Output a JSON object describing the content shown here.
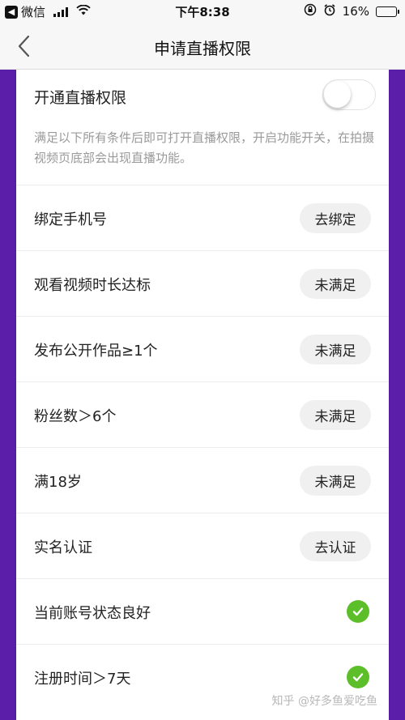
{
  "status_bar": {
    "back_app": "微信",
    "time": "下午8:38",
    "battery": "16%",
    "battery_level": 0.16
  },
  "nav": {
    "title": "申请直播权限"
  },
  "toggle": {
    "label": "开通直播权限",
    "on": false
  },
  "description": "满足以下所有条件后即可打开直播权限，开启功能开关，在拍摄视频页底部会出现直播功能。",
  "requirements": [
    {
      "label": "绑定手机号",
      "action": "去绑定"
    },
    {
      "label": "观看视频时长达标",
      "action": "未满足"
    },
    {
      "label": "发布公开作品≥1个",
      "action": "未满足"
    },
    {
      "label": "粉丝数＞6个",
      "action": "未满足"
    },
    {
      "label": "满18岁",
      "action": "未满足"
    },
    {
      "label": "实名认证",
      "action": "去认证"
    },
    {
      "label": "当前账号状态良好",
      "action": ""
    },
    {
      "label": "注册时间＞7天",
      "action": ""
    }
  ],
  "watermark": "知乎 @好多鱼爱吃鱼",
  "colors": {
    "accent_purple": "#5a1ea8",
    "check_green": "#5cbf2a"
  }
}
